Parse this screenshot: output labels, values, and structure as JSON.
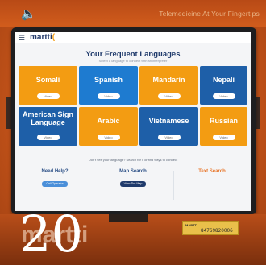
{
  "kiosk": {
    "tagline": "Telemedicine At Your Fingertips",
    "speaker_icon": "speaker-icon",
    "tablet_label": "",
    "watermark": "martti",
    "serial_label": {
      "heading": "MARTTI",
      "number": "84769820006"
    },
    "number_overlay": "20"
  },
  "app": {
    "logo": "martti",
    "menu_icon": "hamburger-menu-icon",
    "title": "Your Frequent Languages",
    "subtitle": "Select a language to connect with an interpreter",
    "languages": [
      {
        "name": "Somali",
        "button": "Video",
        "color": "orange"
      },
      {
        "name": "Spanish",
        "button": "Video",
        "color": "blue"
      },
      {
        "name": "Mandarin",
        "button": "Video",
        "color": "orange"
      },
      {
        "name": "Nepali",
        "button": "Video",
        "color": "navy"
      },
      {
        "name": "American Sign Language",
        "button": "Video",
        "color": "navy"
      },
      {
        "name": "Arabic",
        "button": "Video",
        "color": "orange"
      },
      {
        "name": "Vietnamese",
        "button": "Video",
        "color": "navy"
      },
      {
        "name": "Russian",
        "button": "Video",
        "color": "orange"
      }
    ],
    "not_see_text": "Don't see your language? Search for it or find ways to connect",
    "options": [
      {
        "title": "Need Help?",
        "button": "Call Operator"
      },
      {
        "title": "Map Search",
        "button": "View The Map"
      },
      {
        "title": "Text Search",
        "button": ""
      }
    ]
  },
  "colors": {
    "orange": "#f39c12",
    "blue": "#1e7bd0",
    "navy": "#1e5fa8",
    "housing": "#d25d1d"
  }
}
